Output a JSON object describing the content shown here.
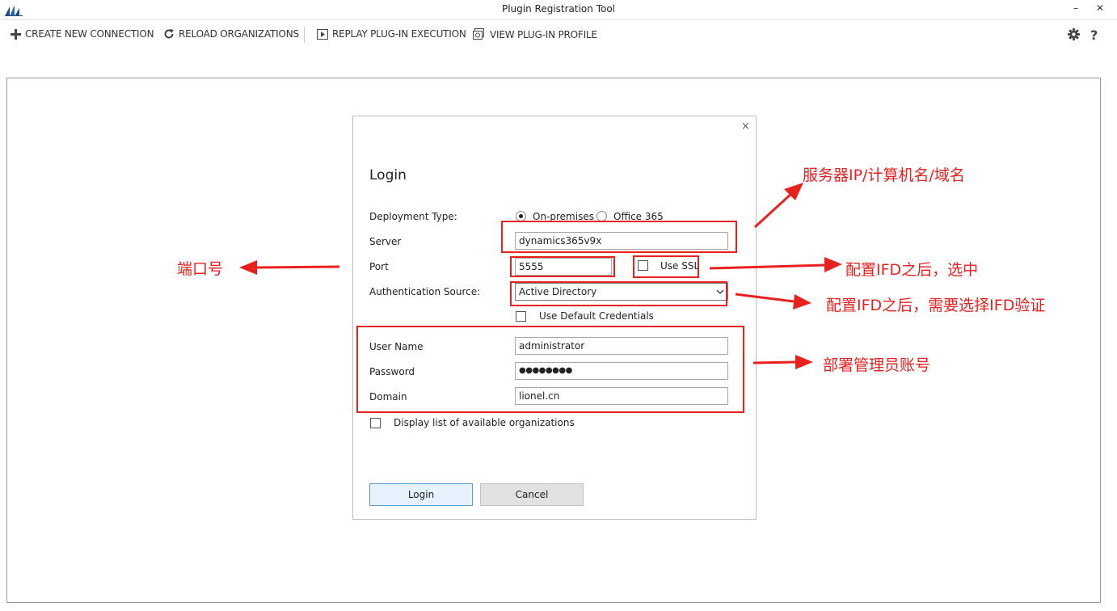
{
  "window": {
    "title": "Plugin Registration Tool",
    "minimize": "–",
    "close": "✕"
  },
  "toolbar": {
    "create_connection": "CREATE NEW CONNECTION",
    "reload_orgs": "RELOAD ORGANIZATIONS",
    "replay_execution": "REPLAY PLUG-IN EXECUTION",
    "view_profile": "VIEW PLUG-IN PROFILE",
    "help": "?"
  },
  "dialog": {
    "close": "×",
    "title": "Login",
    "deployment_type_label": "Deployment Type:",
    "deployment_options": [
      "On-premises",
      "Office 365"
    ],
    "server_label": "Server",
    "server_value": "dynamics365v9x",
    "port_label": "Port",
    "port_value": "5555",
    "use_ssl_label": "Use SSL",
    "auth_source_label": "Authentication Source:",
    "auth_source_value": "Active Directory",
    "use_default_credentials_label": "Use Default Credentials",
    "username_label": "User Name",
    "username_value": "administrator",
    "password_label": "Password",
    "password_value": "●●●●●●●●",
    "domain_label": "Domain",
    "domain_value": "lionel.cn",
    "display_orgs_label": "Display list of available organizations",
    "login_button": "Login",
    "cancel_button": "Cancel"
  },
  "annotations": {
    "server_note": "服务器IP/计算机名/域名",
    "port_note": "端口号",
    "ssl_note": "配置IFD之后，选中",
    "auth_note": "配置IFD之后，需要选择IFD验证",
    "credentials_note": "部署管理员账号"
  },
  "colors": {
    "annotation_red": "#e8211f",
    "login_button_border": "#5a9fd4"
  }
}
